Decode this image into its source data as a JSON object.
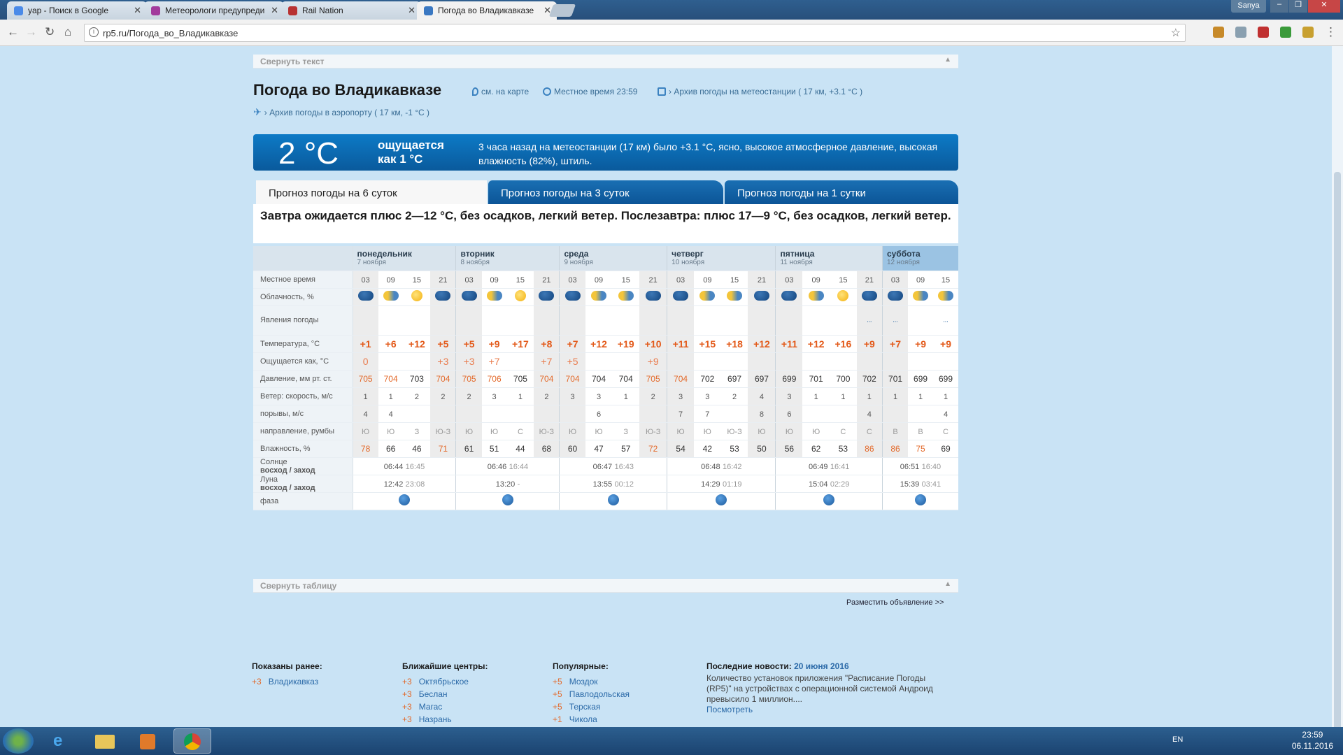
{
  "browser": {
    "tabs": [
      {
        "title": "yap - Поиск в Google",
        "fav": "#4a8ae8"
      },
      {
        "title": "Метеорологи предупреди",
        "fav": "#a23a9c"
      },
      {
        "title": "Rail Nation",
        "fav": "#b83232"
      },
      {
        "title": "Погода во Владикавказе",
        "fav": "#3a78c2"
      }
    ],
    "user": "Sanya",
    "url": "rp5.ru/Погода_во_Владикавказе"
  },
  "page": {
    "collapse_text": "Свернуть текст",
    "title": "Погода во Владикавказе",
    "map_link": "см. на карте",
    "local_time": "Местное время 23:59",
    "station_archive": "› Архив погоды на метеостанции ( 17 км, +3.1 °C )",
    "airport_archive": "› Архив погоды в аэропорту ( 17 км, -1 °C )",
    "now_temp": "2 °C",
    "feels_like": "ощущается как 1 °C",
    "now_text": "3 часа назад на метеостанции (17 км) было +3.1 °C, ясно, высокое атмосферное давление, высокая влажность (82%), штиль.",
    "tabs": [
      "Прогноз погоды на 6 суток",
      "Прогноз погоды на 3 суток",
      "Прогноз погоды на 1 сутки"
    ],
    "tomorrow": "Завтра ожидается плюс 2—12 °C, без осадков, легкий ветер. Послезавтра: плюс 17—9 °C, без осадков, легкий ветер."
  },
  "table": {
    "labels": {
      "time": "Местное время",
      "cloud": "Облачность, %",
      "phen": "Явления погоды",
      "temp": "Температура, °С",
      "feels": "Ощущается как, °С",
      "press": "Давление, мм рт. ст.",
      "wind": "Ветер: скорость, м/с",
      "gust": "порывы, м/с",
      "dir": "направление, румбы",
      "hum": "Влажность, %",
      "sun": "Солнце",
      "sun_sub": "восход / заход",
      "moon": "Луна",
      "moon_sub": "восход / заход",
      "phase": "фаза"
    },
    "days": [
      {
        "name": "понедельник",
        "date": "7 ноября"
      },
      {
        "name": "вторник",
        "date": "8 ноября"
      },
      {
        "name": "среда",
        "date": "9 ноября"
      },
      {
        "name": "четверг",
        "date": "10 ноября"
      },
      {
        "name": "пятница",
        "date": "11 ноября"
      },
      {
        "name": "суббота",
        "date": "12 ноября"
      }
    ],
    "times": [
      "03",
      "09",
      "15",
      "21",
      "03",
      "09",
      "15",
      "21",
      "03",
      "09",
      "15",
      "21",
      "03",
      "09",
      "15",
      "21",
      "03",
      "09",
      "15",
      "21",
      "03",
      "09",
      "15"
    ],
    "clouds": [
      "cloud",
      "scloud",
      "sun",
      "cloud",
      "cloud",
      "scloud",
      "sun",
      "cloud",
      "cloud",
      "scloud",
      "scloud",
      "cloud",
      "cloud",
      "scloud",
      "scloud",
      "cloud",
      "cloud",
      "scloud",
      "sun",
      "cloud",
      "cloud",
      "scloud",
      "scloud"
    ],
    "temps": [
      "+1",
      "+6",
      "+12",
      "+5",
      "+5",
      "+9",
      "+17",
      "+8",
      "+7",
      "+12",
      "+19",
      "+10",
      "+11",
      "+15",
      "+18",
      "+12",
      "+11",
      "+12",
      "+16",
      "+9",
      "+7",
      "+9",
      "+9"
    ],
    "feels": [
      "0",
      "",
      "",
      "+3",
      "+3",
      "+7",
      "",
      "+7",
      "+5",
      "",
      "",
      "+9",
      "",
      "",
      "",
      "",
      "",
      "",
      "",
      "",
      "",
      "",
      ""
    ],
    "press": [
      "705",
      "704",
      "703",
      "704",
      "705",
      "706",
      "705",
      "704",
      "704",
      "704",
      "704",
      "705",
      "704",
      "702",
      "697",
      "697",
      "699",
      "701",
      "700",
      "702",
      "701",
      "699",
      "699"
    ],
    "press_hi": [
      true,
      true,
      false,
      true,
      true,
      true,
      false,
      true,
      true,
      false,
      false,
      true,
      true,
      false,
      false,
      false,
      false,
      false,
      false,
      false,
      false,
      false,
      false
    ],
    "wind": [
      "1",
      "1",
      "2",
      "2",
      "2",
      "3",
      "1",
      "2",
      "3",
      "3",
      "1",
      "2",
      "3",
      "3",
      "2",
      "4",
      "3",
      "1",
      "1",
      "1",
      "1",
      "1",
      "1"
    ],
    "gust": [
      "4",
      "4",
      "",
      "",
      "",
      "",
      "",
      "",
      "",
      "6",
      "",
      "",
      "7",
      "7",
      "",
      "8",
      "6",
      "",
      "",
      "4",
      "",
      "",
      "4"
    ],
    "dir": [
      "Ю",
      "Ю",
      "З",
      "Ю-З",
      "Ю",
      "Ю",
      "С",
      "Ю-З",
      "Ю",
      "Ю",
      "З",
      "Ю-З",
      "Ю",
      "Ю",
      "Ю-З",
      "Ю",
      "Ю",
      "Ю",
      "С",
      "С",
      "В",
      "В",
      "С"
    ],
    "hum": [
      "78",
      "66",
      "46",
      "71",
      "61",
      "51",
      "44",
      "68",
      "60",
      "47",
      "57",
      "72",
      "54",
      "42",
      "53",
      "50",
      "56",
      "62",
      "53",
      "86",
      "86",
      "75",
      "69"
    ],
    "hum_hi": [
      true,
      false,
      false,
      true,
      false,
      false,
      false,
      false,
      false,
      false,
      false,
      true,
      false,
      false,
      false,
      false,
      false,
      false,
      false,
      true,
      true,
      true,
      false
    ],
    "sun": [
      {
        "rise": "06:44",
        "set": "16:45"
      },
      {
        "rise": "06:46",
        "set": "16:44"
      },
      {
        "rise": "06:47",
        "set": "16:43"
      },
      {
        "rise": "06:48",
        "set": "16:42"
      },
      {
        "rise": "06:49",
        "set": "16:41"
      },
      {
        "rise": "06:51",
        "set": "16:40"
      }
    ],
    "moon": [
      {
        "rise": "12:42",
        "set": "23:08"
      },
      {
        "rise": "13:20",
        "set": "-"
      },
      {
        "rise": "13:55",
        "set": "00:12"
      },
      {
        "rise": "14:29",
        "set": "01:19"
      },
      {
        "rise": "15:04",
        "set": "02:29"
      },
      {
        "rise": "15:39",
        "set": "03:41"
      }
    ],
    "collapse": "Свернуть таблицу",
    "ad": "Разместить объявление >>"
  },
  "footer": {
    "shown_title": "Показаны ранее:",
    "shown": [
      {
        "t": "+3",
        "name": "Владикавказ"
      }
    ],
    "near_title": "Ближайшие центры:",
    "near": [
      {
        "t": "+3",
        "name": "Октябрьское"
      },
      {
        "t": "+3",
        "name": "Беслан"
      },
      {
        "t": "+3",
        "name": "Магас"
      },
      {
        "t": "+3",
        "name": "Назрань"
      }
    ],
    "pop_title": "Популярные:",
    "pop": [
      {
        "t": "+5",
        "name": "Моздок"
      },
      {
        "t": "+5",
        "name": "Павлодольская"
      },
      {
        "t": "+5",
        "name": "Терская"
      },
      {
        "t": "+1",
        "name": "Чикола"
      }
    ],
    "news_title": "Последние новости:",
    "news_date": "20 июня 2016",
    "news_text": "Количество установок приложения \"Расписание Погоды (RP5)\" на устройствах с операционной системой Андроид превысило 1 миллион....",
    "news_link": "Посмотреть"
  },
  "taskbar": {
    "lang": "EN",
    "time": "23:59",
    "date": "06.11.2016"
  }
}
